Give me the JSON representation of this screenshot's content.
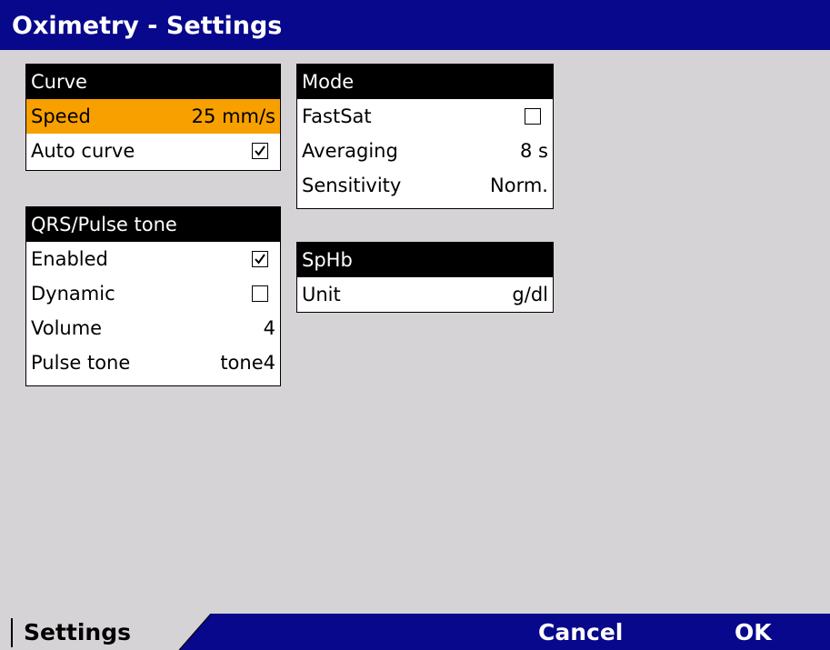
{
  "title": "Oximetry - Settings",
  "curve": {
    "header": "Curve",
    "speed_label": "Speed",
    "speed_value": "25 mm/s",
    "auto_curve_label": "Auto curve",
    "auto_curve_checked": true
  },
  "mode": {
    "header": "Mode",
    "fastsat_label": "FastSat",
    "fastsat_checked": false,
    "averaging_label": "Averaging",
    "averaging_value": "8 s",
    "sensitivity_label": "Sensitivity",
    "sensitivity_value": "Norm."
  },
  "qrs": {
    "header": "QRS/Pulse tone",
    "enabled_label": "Enabled",
    "enabled_checked": true,
    "dynamic_label": "Dynamic",
    "dynamic_checked": false,
    "volume_label": "Volume",
    "volume_value": "4",
    "pulse_tone_label": "Pulse tone",
    "pulse_tone_value": "tone4"
  },
  "sphb": {
    "header": "SpHb",
    "unit_label": "Unit",
    "unit_value": "g/dl"
  },
  "bottom": {
    "tab_label": "Settings",
    "cancel_label": "Cancel",
    "ok_label": "OK"
  },
  "colors": {
    "title_bar": "#08088c",
    "selected_row": "#f7a000",
    "background": "#d6d3d6"
  }
}
